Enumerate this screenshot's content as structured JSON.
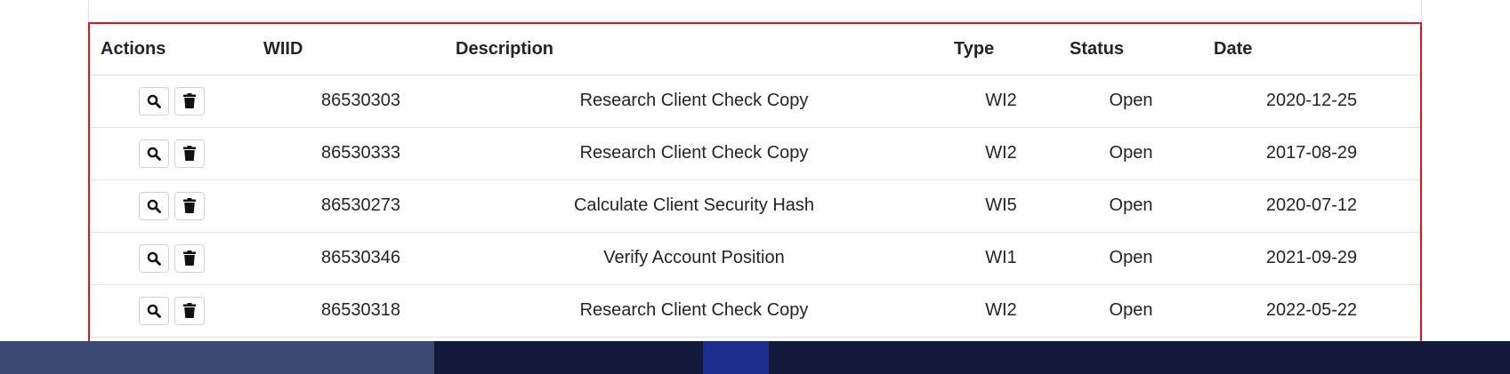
{
  "table": {
    "headers": {
      "actions": "Actions",
      "wiid": "WIID",
      "description": "Description",
      "type": "Type",
      "status": "Status",
      "date": "Date"
    },
    "rows": [
      {
        "wiid": "86530303",
        "description": "Research Client Check Copy",
        "type": "WI2",
        "status": "Open",
        "date": "2020-12-25"
      },
      {
        "wiid": "86530333",
        "description": "Research Client Check Copy",
        "type": "WI2",
        "status": "Open",
        "date": "2017-08-29"
      },
      {
        "wiid": "86530273",
        "description": "Calculate Client Security Hash",
        "type": "WI5",
        "status": "Open",
        "date": "2020-07-12"
      },
      {
        "wiid": "86530346",
        "description": "Verify Account Position",
        "type": "WI1",
        "status": "Open",
        "date": "2021-09-29"
      },
      {
        "wiid": "86530318",
        "description": "Research Client Check Copy",
        "type": "WI2",
        "status": "Open",
        "date": "2022-05-22"
      }
    ],
    "row_actions": [
      "search-icon",
      "trash-icon"
    ]
  },
  "colors": {
    "highlight": "#e8141c",
    "taskbar": "#141a3b",
    "border": "#dee2e6"
  }
}
